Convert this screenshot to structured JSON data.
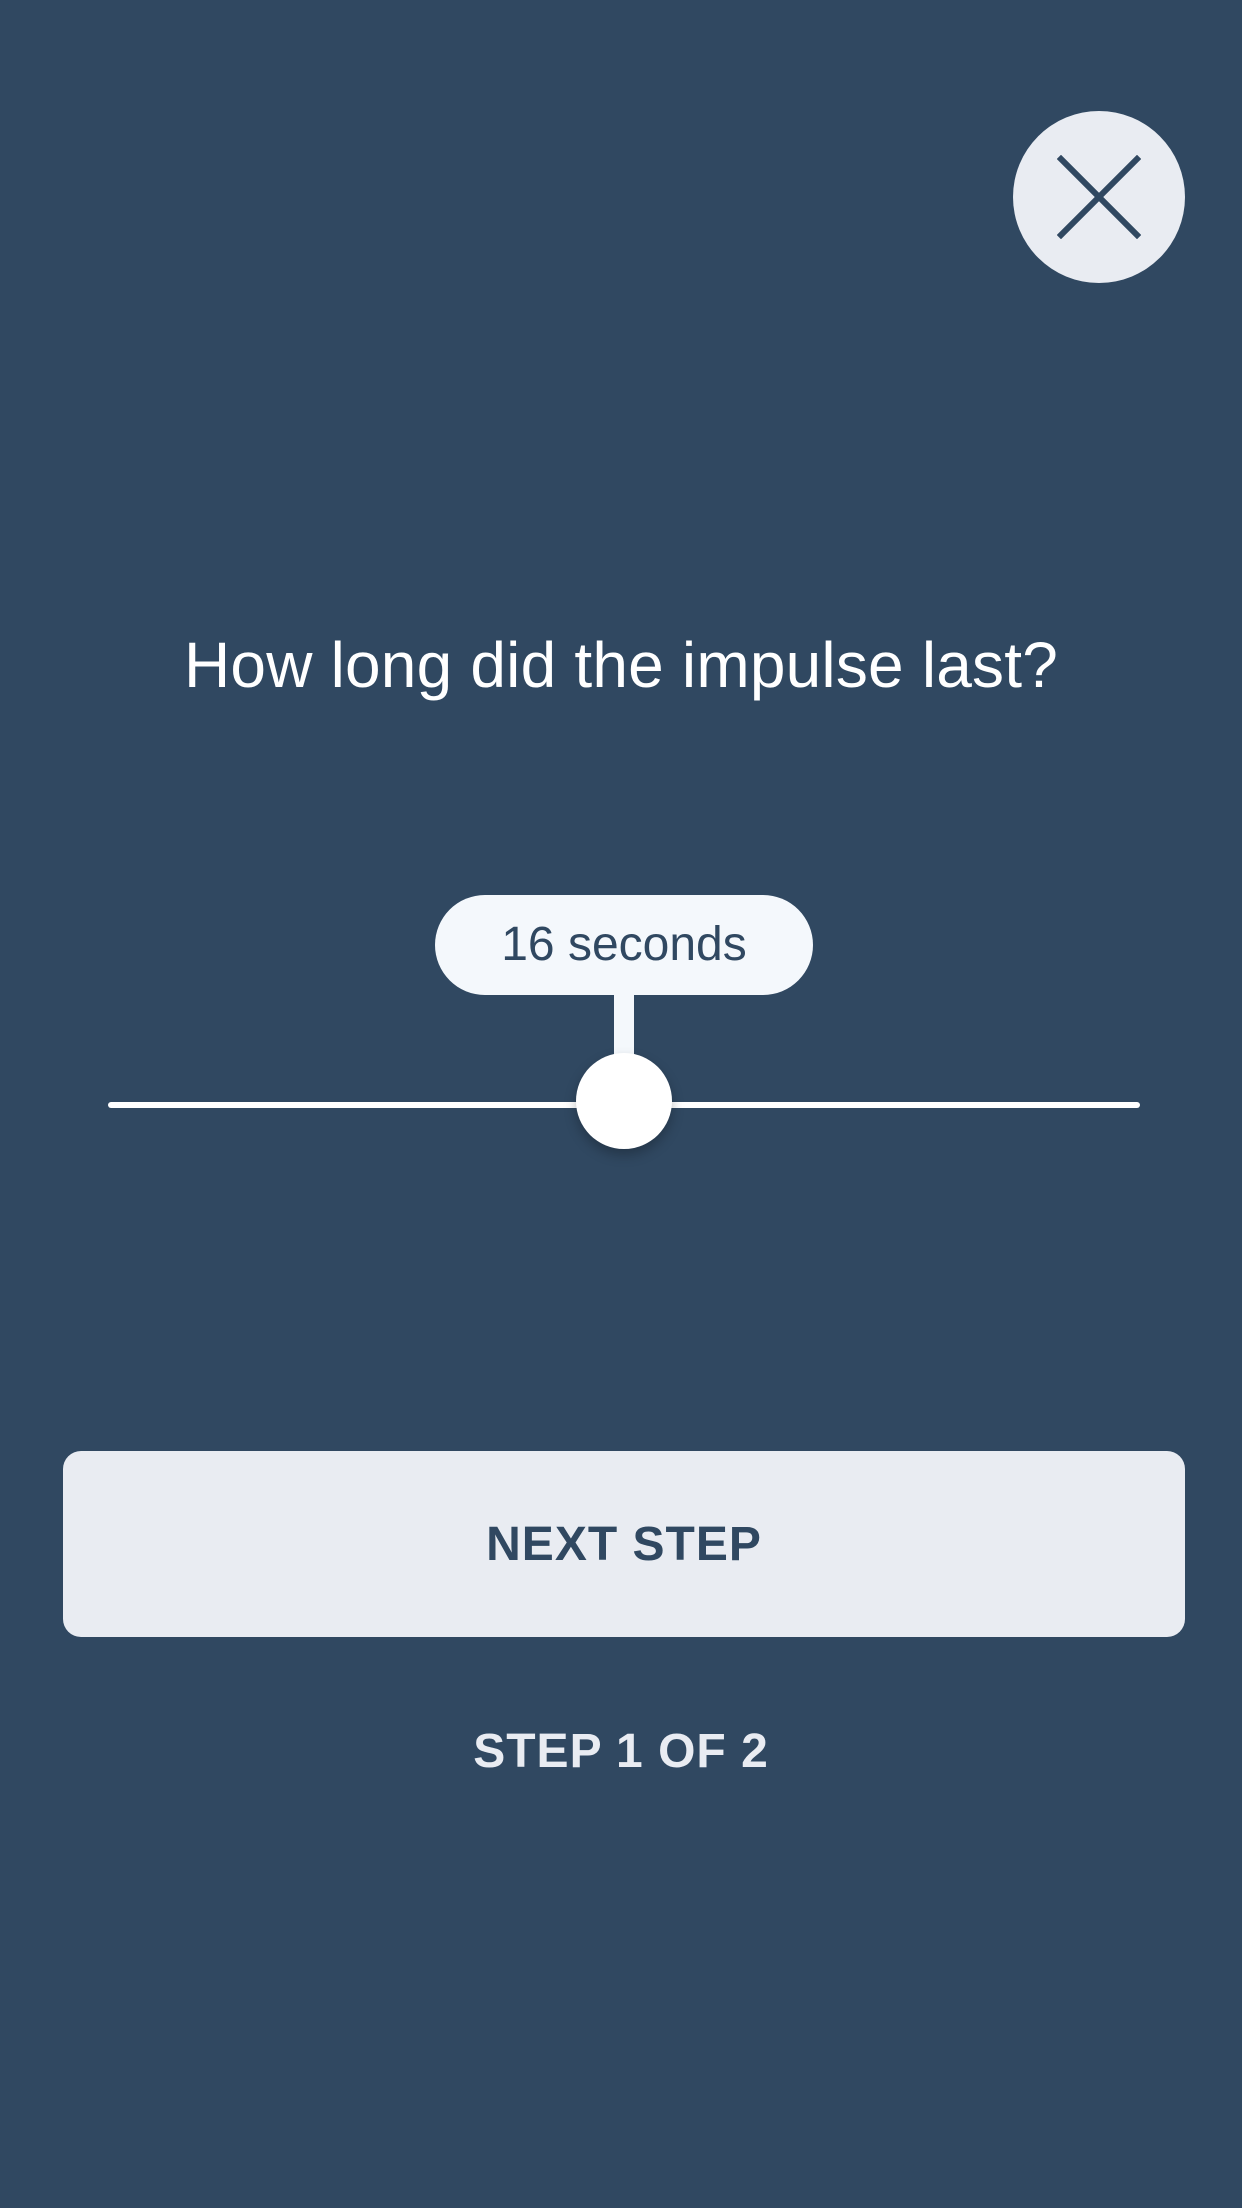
{
  "screen": {
    "background_color": "#304861"
  },
  "close": {
    "icon": "close-icon",
    "background_color": "#e9ecf2",
    "icon_color": "#304861"
  },
  "question": {
    "text": "How long did the impulse last?"
  },
  "slider": {
    "value_label": "16 seconds",
    "position_fraction": 0.5,
    "track_color": "#ffffff",
    "thumb_color": "#ffffff",
    "bubble_color": "#f4f8fc"
  },
  "actions": {
    "next_label": "NEXT STEP",
    "next_button_color": "#e9ecf2"
  },
  "progress": {
    "step_text": "STEP 1 OF 2"
  }
}
